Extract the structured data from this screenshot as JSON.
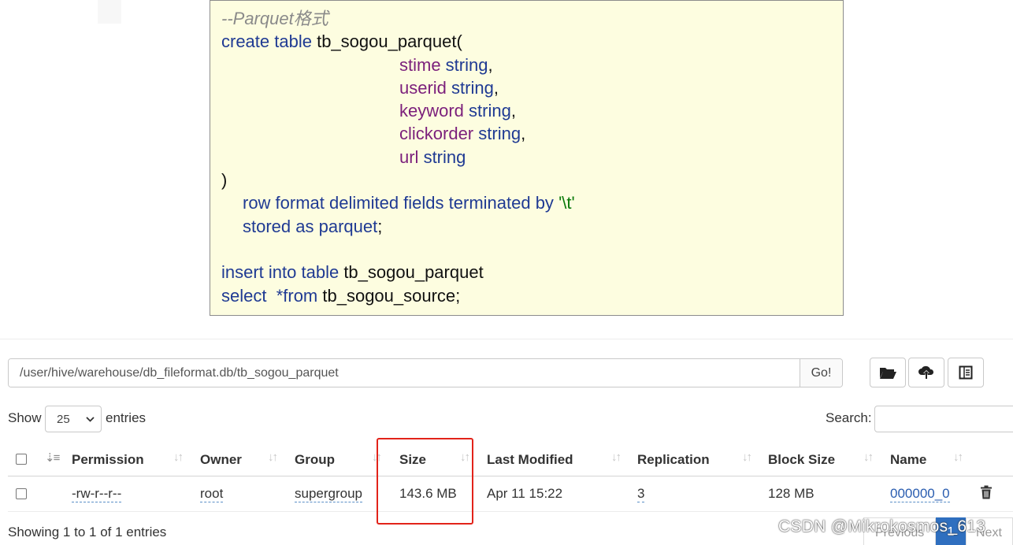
{
  "code": {
    "comment": "--Parquet格式",
    "l1_kw": "create table ",
    "l1_name": "tb_sogou_parquet(",
    "fields": [
      {
        "name": "stime",
        "type": " string",
        "end": ","
      },
      {
        "name": "userid",
        "type": " string",
        "end": ","
      },
      {
        "name": "keyword",
        "type": " string",
        "end": ","
      },
      {
        "name": "clickorder",
        "type": " string",
        "end": ","
      },
      {
        "name": "url",
        "type": " string",
        "end": ""
      }
    ],
    "close": ")",
    "row_format": "row format delimited fields terminated by ",
    "delim": "'\\t'",
    "stored_as": "stored as parquet",
    "semi": ";",
    "ins_kw": "insert into table ",
    "ins_name": "tb_sogou_parquet",
    "sel_kw": "select  *from ",
    "sel_name": "tb_sogou_source;"
  },
  "path_bar": {
    "path": "/user/hive/warehouse/db_fileformat.db/tb_sogou_parquet",
    "go_label": "Go!"
  },
  "toolbar": {
    "icons": [
      "folder-open-icon",
      "cloud-upload-icon",
      "file-list-icon"
    ]
  },
  "controls": {
    "show": "Show",
    "page_size": "25",
    "entries": "entries",
    "search": "Search:",
    "search_value": ""
  },
  "table": {
    "headers": [
      "Permission",
      "Owner",
      "Group",
      "Size",
      "Last Modified",
      "Replication",
      "Block Size",
      "Name"
    ],
    "rows": [
      {
        "permission": "-rw-r--r--",
        "owner": "root",
        "group": "supergroup",
        "size": "143.6 MB",
        "modified": "Apr 11 15:22",
        "replication": "3",
        "block_size": "128 MB",
        "name": "000000_0"
      }
    ]
  },
  "footer": {
    "showing": "Showing 1 to 1 of 1 entries",
    "previous": "Previous",
    "current_page": "1",
    "next": "Next"
  },
  "watermark": "CSDN @Mikrokosmos_613",
  "colors": {
    "highlight": "#e2231a",
    "code_bg": "#fdfde0",
    "keyword": "#1f3a93",
    "field": "#7b1f7b",
    "link": "#2a5db0",
    "pager_active": "#2f6fbf"
  }
}
